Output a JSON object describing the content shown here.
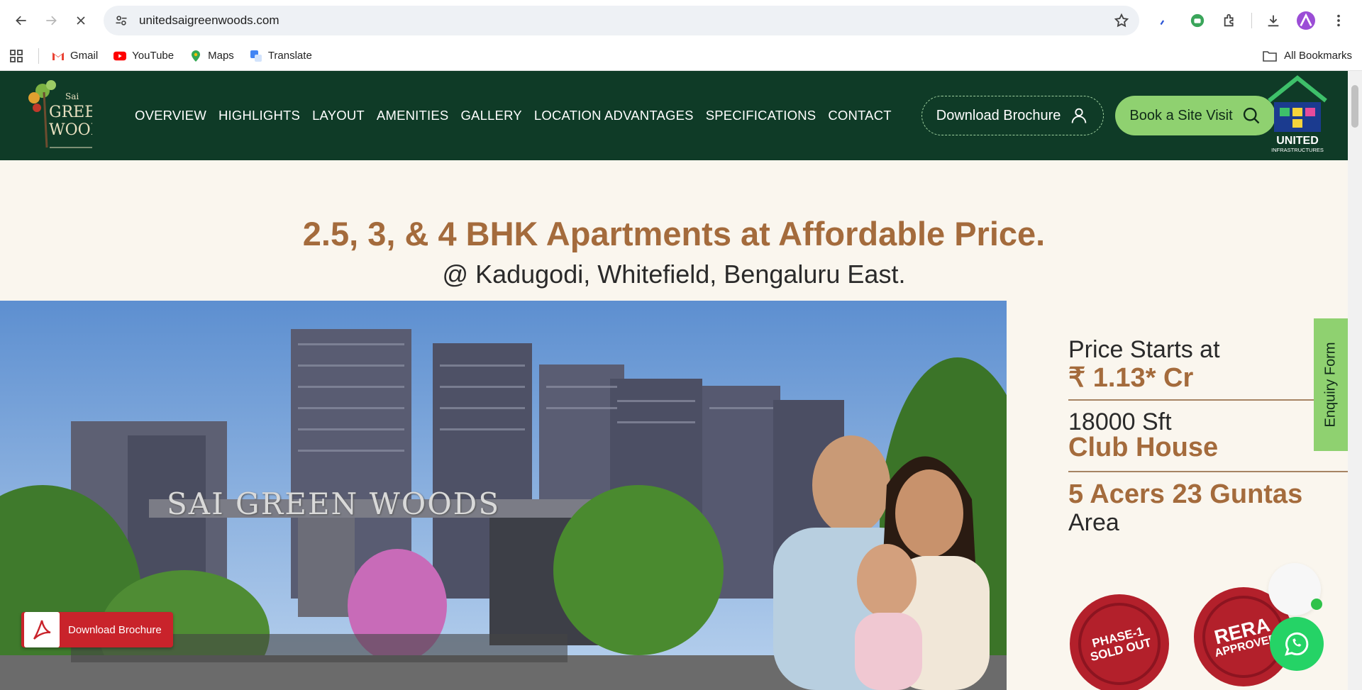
{
  "browser": {
    "url": "unitedsaigreenwoods.com",
    "bookmarks": [
      {
        "label": "Gmail",
        "icon": "gmail-icon"
      },
      {
        "label": "YouTube",
        "icon": "youtube-icon"
      },
      {
        "label": "Maps",
        "icon": "maps-icon"
      },
      {
        "label": "Translate",
        "icon": "translate-icon"
      }
    ],
    "all_bookmarks": "All Bookmarks"
  },
  "header": {
    "logo": {
      "line1": "Sai",
      "line2": "GREEN",
      "line3": "WOODS"
    },
    "nav": [
      "OVERVIEW",
      "HIGHLIGHTS",
      "LAYOUT",
      "AMENITIES",
      "GALLERY",
      "LOCATION ADVANTAGES",
      "SPECIFICATIONS",
      "CONTACT"
    ],
    "download_brochure": "Download Brochure",
    "book_visit": "Book a Site Visit",
    "brand": {
      "name": "UNITED",
      "sub": "INFRASTRUCTURES"
    }
  },
  "hero": {
    "headline": "2.5, 3, & 4 BHK Apartments at Affordable Price.",
    "subline": "@ Kadugodi, Whitefield, Bengaluru East.",
    "photo_sign": "SAI GREEN WOODS",
    "price_label": "Price Starts at",
    "price_value": "₹ 1.13* Cr",
    "club_size": "18000 Sft",
    "club_label": "Club House",
    "area_value": "5 Acers 23 Guntas",
    "area_label": "Area",
    "seal1_line1": "PHASE-1",
    "seal1_line2": "SOLD OUT",
    "seal2_line1": "RERA",
    "seal2_line2": "APPROVED",
    "enquiry_form": "Enquiry Form",
    "pdf_button": "Download Brochure"
  },
  "colors": {
    "header_bg": "#0f3b27",
    "accent_green": "#8fd170",
    "brown": "#a46b3c",
    "cream": "#faf6ee"
  }
}
